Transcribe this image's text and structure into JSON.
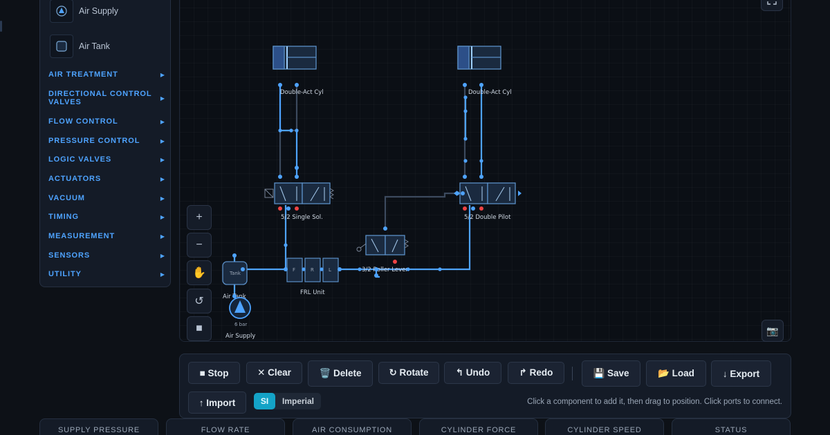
{
  "sidebar": {
    "components": [
      {
        "label": "Air Supply",
        "icon": "air-supply-icon"
      },
      {
        "label": "Air Tank",
        "icon": "air-tank-icon"
      }
    ],
    "categories": [
      "AIR TREATMENT",
      "DIRECTIONAL CONTROL VALVES",
      "FLOW CONTROL",
      "PRESSURE CONTROL",
      "LOGIC VALVES",
      "ACTUATORS",
      "VACUUM",
      "TIMING",
      "MEASUREMENT",
      "SENSORS",
      "UTILITY"
    ]
  },
  "canvas": {
    "labels": {
      "cyl1": "Double-Act Cyl",
      "cyl2": "Double-Act Cyl",
      "valve1": "5/2 Single Sol.",
      "valve2": "5/2 Double Pilot",
      "roller": "3/2 Roller Lever",
      "frl": "FRL Unit",
      "frl_f": "F",
      "frl_r": "R",
      "frl_l": "L",
      "tank_inner": "Tank",
      "tank": "Air Tank",
      "supply_pressure": "6 bar",
      "supply": "Air Supply"
    },
    "controls": {
      "zoom_in": "+",
      "zoom_out": "−",
      "pan": "✋",
      "reset": "↺",
      "stop": "■"
    },
    "colors": {
      "pipe_active": "#4ea3ff",
      "pipe_idle": "#3c4a5e",
      "component_fill": "#1a2a3f",
      "component_stroke": "#5b8fc7",
      "port_active": "#4ea3ff",
      "port_exhaust": "#ef4444"
    }
  },
  "toolbar": {
    "stop": "■ Stop",
    "clear": "✕ Clear",
    "delete": "🗑️ Delete",
    "rotate": "↻ Rotate",
    "undo": "↰ Undo",
    "redo": "↱ Redo",
    "save": "💾 Save",
    "load": "📂 Load",
    "export": "↓ Export",
    "import": "↑ Import",
    "unit_si": "SI",
    "unit_imperial": "Imperial",
    "hint": "Click a component to add it, then drag to position. Click ports to connect."
  },
  "metrics": [
    "SUPPLY PRESSURE",
    "FLOW RATE",
    "AIR CONSUMPTION",
    "CYLINDER FORCE",
    "CYLINDER SPEED",
    "STATUS"
  ]
}
